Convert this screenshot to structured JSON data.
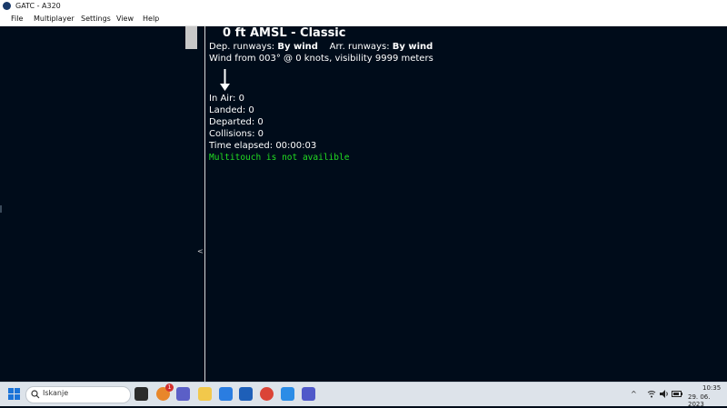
{
  "window": {
    "title": "GATC - A320"
  },
  "menu": [
    "File",
    "Multiplayer",
    "Settings",
    "View",
    "Help"
  ],
  "left_panel": {
    "collapse_glyph": "<"
  },
  "main": {
    "headline": "0 ft AMSL - Classic",
    "runways": {
      "dep_label": "Dep. runways:",
      "dep_value": "By wind",
      "arr_label": "Arr. runways:",
      "arr_value": "By wind"
    },
    "weather": "Wind from 003° @ 0 knots, visibility 9999 meters",
    "stats": [
      "In Air: 0",
      "Landed: 0",
      "Departed: 0",
      "Collisions: 0",
      "Time elapsed: 00:00:03"
    ],
    "notice": "Multitouch is not availible",
    "notice_color": "#22dd22"
  },
  "taskbar": {
    "search_placeholder": "Iskanje",
    "notification_badge": "1",
    "time": "10:35",
    "date": "29. 06. 2023",
    "icons": [
      "windows-start-icon",
      "search-icon",
      "task-view-icon",
      "browser-icon",
      "chat-icon",
      "file-explorer-icon",
      "folder-icon",
      "mail-icon",
      "word-icon",
      "chrome-icon",
      "vscode-icon",
      "teams-icon"
    ]
  }
}
